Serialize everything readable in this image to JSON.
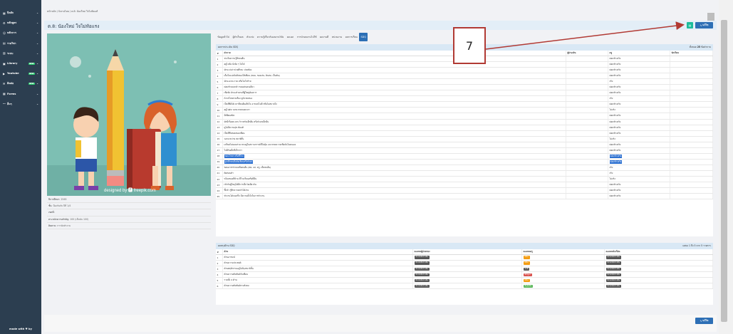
{
  "sidebar": {
    "items": [
      {
        "label": "ปีหลัก",
        "icon": "building-icon",
        "badge": ""
      },
      {
        "label": "หลักสูตร",
        "icon": "cog-icon",
        "badge": ""
      },
      {
        "label": "หลักการ",
        "icon": "users-icon",
        "badge": ""
      },
      {
        "label": "รายวิชา",
        "icon": "book-icon",
        "badge": ""
      },
      {
        "label": "ระบบ",
        "icon": "grid-icon",
        "badge": ""
      },
      {
        "label": "Library",
        "icon": "library-icon",
        "badge": "NEW"
      },
      {
        "label": "Youtube",
        "icon": "youtube-icon",
        "badge": "NEW"
      },
      {
        "label": "ติดต่อ",
        "icon": "contact-icon",
        "badge": "NEW"
      },
      {
        "label": "Forms",
        "icon": "forms-icon",
        "badge": ""
      },
      {
        "label": "อื่นๆ",
        "icon": "more-icon",
        "badge": ""
      }
    ],
    "footer": "made with ♥ by"
  },
  "breadcrumb": "หน้าหลัก / นิทานไทย / ต.8: น้องใหม่ ใจไม่ท้อแท้",
  "page_title": "ต.8: น้องใหม่ ใจไม่ท้อแรง",
  "buttons": {
    "edit": "แก้ไข",
    "export_icon": "excel-icon",
    "bottom_edit": "แก้ไข"
  },
  "illustration": {
    "credit": "designed by 🅵 freepik.com"
  },
  "info": [
    {
      "label": "ปีการศึกษา:",
      "value": "2565"
    },
    {
      "label": "ชั้น:",
      "value": "ป้องกันภัย ปีที่ 1/4"
    },
    {
      "label": "เขตที่:",
      "value": ""
    },
    {
      "label": "ตระหนักความสำคัญ:",
      "value": "100 (เต็มนับ 100)"
    },
    {
      "label": "ติดตาม:",
      "value": "การจัดทำงาน"
    }
  ],
  "tabs": [
    {
      "label": "ข้อมูลทั่วไป",
      "active": false
    },
    {
      "label": "ผู้สำเร็จผล",
      "active": false
    },
    {
      "label": "ตัวแข่ง",
      "active": false
    },
    {
      "label": "ความรู้เกี่ยวกับผลงานวิจัย",
      "active": false
    },
    {
      "label": "ผล.ผล",
      "active": false
    },
    {
      "label": "การนำผลงานไปใช้",
      "active": false
    },
    {
      "label": "ผลงานดี",
      "active": false
    },
    {
      "label": "หน่วยงาน",
      "active": false
    },
    {
      "label": "ผลการเรียน",
      "active": false
    },
    {
      "label": "SDQ",
      "active": true
    }
  ],
  "sdq_panel": {
    "title": "ผลการประเมิน SDQ",
    "count_prefix": "ทั้งหมด",
    "count": "25",
    "count_suffix": "ข้อคำถาม",
    "headers": [
      "#",
      "คำถาม",
      "ผู้ประเมิน",
      "ครู",
      "นักเรียน"
    ],
    "rows": [
      {
        "n": "1",
        "q": "ห่วงใยความรู้สึกคนอื่น",
        "a": "",
        "t": "ค่อนข้างจริง",
        "s": "",
        "hl": false
      },
      {
        "n": "2",
        "q": "อยู่ไม่นิ่ง นั่งนิ่ง ๆ ไม่ได้",
        "a": "",
        "t": "ค่อนข้างจริง",
        "s": "",
        "hl": false
      },
      {
        "n": "3",
        "q": "มักจะบ่นว่าปวดศีรษะ ปวดท้อง",
        "a": "",
        "t": "ค่อนข้างจริง",
        "s": "",
        "hl": false
      },
      {
        "n": "4",
        "q": "เต็มใจแบ่งปันสิ่งของให้เพื่อน (ขนม, ของเล่น, ดินสอ, เป็นต้น)",
        "a": "",
        "t": "ค่อนข้างจริง",
        "s": "",
        "hl": false
      },
      {
        "n": "5",
        "q": "มักจะอาละวาด หรือโมโหร้าย",
        "a": "",
        "t": "จริง",
        "s": "",
        "hl": false
      },
      {
        "n": "6",
        "q": "ค่อนข้างแยกตัว ชอบเล่นคนเดียว",
        "a": "",
        "t": "ค่อนข้างจริง",
        "s": "",
        "hl": false
      },
      {
        "n": "7",
        "q": "เชื่อฟัง มักจะทำตามที่ผู้ใหญ่ต้องการ",
        "a": "",
        "t": "ค่อนข้างจริง",
        "s": "",
        "hl": false
      },
      {
        "n": "8",
        "q": "กังวลใจหลายเรื่อง ดูกังวลเสมอ",
        "a": "",
        "t": "จริง",
        "s": "",
        "hl": false
      },
      {
        "n": "9",
        "q": "เป็นที่พึ่งได้เวลาที่คนอื่นเสียใจ อารมณ์ไม่ดี หรือไม่สบายใจ",
        "a": "",
        "t": "ค่อนข้างจริง",
        "s": "",
        "hl": false
      },
      {
        "n": "10",
        "q": "อยู่ไม่สุข วอกแวกตลอดเวลา",
        "a": "",
        "t": "ไม่จริง",
        "s": "",
        "hl": false
      },
      {
        "n": "11",
        "q": "มีเพื่อนสนิท",
        "a": "",
        "t": "ค่อนข้างจริง",
        "s": "",
        "hl": false
      },
      {
        "n": "12",
        "q": "มักมีเรื่องทะเลาะวิวาทกับเด็กอื่น หรือรังแกเด็กอื่น",
        "a": "",
        "t": "ค่อนข้างจริง",
        "s": "",
        "hl": false
      },
      {
        "n": "13",
        "q": "ดูไม่มีความสุข ท้อแท้",
        "a": "",
        "t": "ค่อนข้างจริง",
        "s": "",
        "hl": false
      },
      {
        "n": "14",
        "q": "เป็นที่ชื่นชอบของเพื่อน",
        "a": "",
        "t": "ค่อนข้างจริง",
        "s": "",
        "hl": false
      },
      {
        "n": "15",
        "q": "วอกแวกง่าย สมาธิสั้น",
        "a": "",
        "t": "ไม่จริง",
        "s": "",
        "hl": false
      },
      {
        "n": "16",
        "q": "เครียดไม่ยอมห่างเวลาอยู่ในสถานการณ์ที่ไม่คุ้น และขาดความเชื่อมั่นในตนเอง",
        "a": "",
        "t": "ค่อนข้างจริง",
        "s": "",
        "hl": false
      },
      {
        "n": "17",
        "q": "ใจดีกับเด็กที่เล็กกว่า",
        "a": "",
        "t": "ค่อนข้างจริง",
        "s": "",
        "hl": false
      },
      {
        "n": "18",
        "q": "ชอบโกหก หรือขี้โกง",
        "a": "",
        "t": "ค่อนข้างจริง",
        "s": "",
        "hl": true
      },
      {
        "n": "19",
        "q": "ถูกเด็กคนอื่นล้อเลียนหรือรังแก",
        "a": "",
        "t": "ค่อนข้างจริง",
        "s": "",
        "hl": true
      },
      {
        "n": "20",
        "q": "ชอบอาสาช่วยเหลือคนอื่น (พ่อ, แม่, ครู, เด็กคนอื่น)",
        "a": "",
        "t": "จริง",
        "s": "",
        "hl": false
      },
      {
        "n": "21",
        "q": "คิดก่อนทำ",
        "a": "",
        "t": "จริง",
        "s": "",
        "hl": false
      },
      {
        "n": "22",
        "q": "ขโมยของที่บ้าน ที่โรงเรียนหรือที่อื่น",
        "a": "",
        "t": "ไม่จริง",
        "s": "",
        "hl": false
      },
      {
        "n": "23",
        "q": "เข้ากับผู้ใหญ่ได้ดีกว่าเด็กวัยเดียวกัน",
        "a": "",
        "t": "ค่อนข้างจริง",
        "s": "",
        "hl": false
      },
      {
        "n": "24",
        "q": "ขี้กลัว รู้สึกหวาดกลัวได้ง่าย",
        "a": "",
        "t": "ค่อนข้างจริง",
        "s": "",
        "hl": false
      },
      {
        "n": "25",
        "q": "ทำงานได้จนเสร็จ มีความตั้งใจในการทำงาน",
        "a": "",
        "t": "ค่อนข้างจริง",
        "s": "",
        "hl": false
      }
    ]
  },
  "result_panel": {
    "title": "ผลสรุปด้าน SDQ",
    "info": "แสดง 1 ถึง 5 จาก 5 รายการ",
    "headers": [
      "#",
      "ด้าน",
      "คะแนนผู้ปกครอง",
      "คะแนนครู",
      "คะแนนนักเรียน"
    ],
    "rows": [
      {
        "n": "1",
        "name": "ด้านอารมณ์",
        "p": {
          "label": "ยังไม่ได้ประเมิน",
          "color": "#555555"
        },
        "t": {
          "label": "เสี่ยง",
          "color": "#f39c12"
        },
        "s": {
          "label": "ยังไม่ได้ประเมิน",
          "color": "#555555"
        }
      },
      {
        "n": "2",
        "name": "ด้านความประพฤติ",
        "p": {
          "label": "ยังไม่ได้ประเมิน",
          "color": "#555555"
        },
        "t": {
          "label": "เสี่ยง",
          "color": "#f39c12"
        },
        "s": {
          "label": "ยังไม่ได้ประเมิน",
          "color": "#555555"
        }
      },
      {
        "n": "3",
        "name": "ด้านพฤติกรรมอยู่ไม่นิ่ง/สมาธิสั้น",
        "p": {
          "label": "ยังไม่ได้ประเมิน",
          "color": "#555555"
        },
        "t": {
          "label": "ปกติ",
          "color": "#555555"
        },
        "s": {
          "label": "ยังไม่ได้ประเมิน",
          "color": "#555555"
        }
      },
      {
        "n": "4",
        "name": "ด้านความสัมพันธ์กับเพื่อน",
        "p": {
          "label": "ยังไม่ได้ประเมิน",
          "color": "#555555"
        },
        "t": {
          "label": "มีปัญหา",
          "color": "#d9534f"
        },
        "s": {
          "label": "ยังไม่ได้ประเมิน",
          "color": "#555555"
        }
      },
      {
        "n": "5",
        "name": "รวมทั้ง 4 ด้าน",
        "p": {
          "label": "ยังไม่ได้ประเมิน",
          "color": "#555555"
        },
        "t": {
          "label": "เสี่ยง",
          "color": "#f39c12"
        },
        "s": {
          "label": "ยังไม่ได้ประเมิน",
          "color": "#555555"
        }
      },
      {
        "n": "6",
        "name": "ด้านความสัมพันธ์ทางสังคม",
        "p": {
          "label": "ยังไม่ได้ประเมิน",
          "color": "#555555"
        },
        "t": {
          "label": "มีจุดแข็ง",
          "color": "#5cb85c"
        },
        "s": {
          "label": "ยังไม่ได้ประเมิน",
          "color": "#555555"
        }
      }
    ]
  },
  "annotation": {
    "label": "7"
  }
}
